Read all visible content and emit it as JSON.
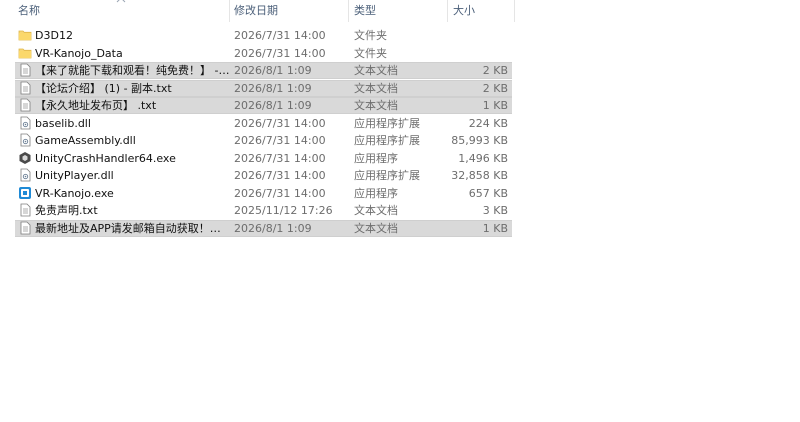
{
  "columns": {
    "name": "名称",
    "date": "修改日期",
    "type": "类型",
    "size": "大小"
  },
  "rows": [
    {
      "name": "D3D12",
      "date": "2026/7/31 14:00",
      "type": "文件夹",
      "size": "",
      "icon": "folder-icon",
      "selected": false
    },
    {
      "name": "VR-Kanojo_Data",
      "date": "2026/7/31 14:00",
      "type": "文件夹",
      "size": "",
      "icon": "folder-icon",
      "selected": false
    },
    {
      "name": "【来了就能下载和观看！纯免费！】 - 副...",
      "date": "2026/8/1 1:09",
      "type": "文本文档",
      "size": "2 KB",
      "icon": "text-file-icon",
      "selected": true
    },
    {
      "name": "【论坛介绍】 (1) - 副本.txt",
      "date": "2026/8/1 1:09",
      "type": "文本文档",
      "size": "2 KB",
      "icon": "text-file-icon",
      "selected": true
    },
    {
      "name": "【永久地址发布页】 .txt",
      "date": "2026/8/1 1:09",
      "type": "文本文档",
      "size": "1 KB",
      "icon": "text-file-icon",
      "selected": true
    },
    {
      "name": "baselib.dll",
      "date": "2026/7/31 14:00",
      "type": "应用程序扩展",
      "size": "224 KB",
      "icon": "dll-file-icon",
      "selected": false
    },
    {
      "name": "GameAssembly.dll",
      "date": "2026/7/31 14:00",
      "type": "应用程序扩展",
      "size": "85,993 KB",
      "icon": "dll-file-icon",
      "selected": false
    },
    {
      "name": "UnityCrashHandler64.exe",
      "date": "2026/7/31 14:00",
      "type": "应用程序",
      "size": "1,496 KB",
      "icon": "unity-exe-icon",
      "selected": false
    },
    {
      "name": "UnityPlayer.dll",
      "date": "2026/7/31 14:00",
      "type": "应用程序扩展",
      "size": "32,858 KB",
      "icon": "dll-file-icon",
      "selected": false
    },
    {
      "name": "VR-Kanojo.exe",
      "date": "2026/7/31 14:00",
      "type": "应用程序",
      "size": "657 KB",
      "icon": "app-exe-icon",
      "selected": false
    },
    {
      "name": "免责声明.txt",
      "date": "2025/11/12 17:26",
      "type": "文本文档",
      "size": "3 KB",
      "icon": "text-file-icon",
      "selected": false
    },
    {
      "name": "最新地址及APP请发邮箱自动获取！！！...",
      "date": "2026/8/1 1:09",
      "type": "文本文档",
      "size": "1 KB",
      "icon": "text-file-icon",
      "selected": true
    }
  ]
}
